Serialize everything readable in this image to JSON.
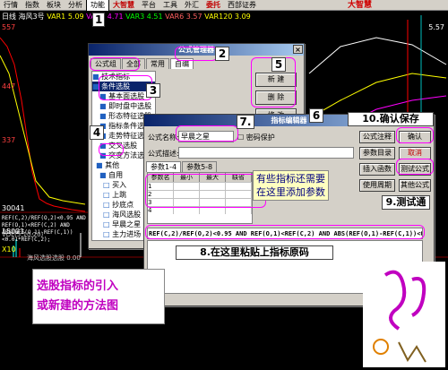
{
  "menu": [
    "行情",
    "指数",
    "板块",
    "分析",
    "功能",
    "大智慧",
    "平台",
    "工具",
    "外汇",
    "委托",
    "西部证券"
  ],
  "brand": "大智慧",
  "infoline": {
    "name": "海风3号",
    "ma1": "VAR1 5.09",
    "ma2": "VAR2 4.71",
    "ma3": "VAR3 4.51",
    "ma4": "VAR6 3.57",
    "ma5": "VAR120 3.09",
    "period": "日线"
  },
  "yticks_left": [
    "557",
    "447",
    "337"
  ],
  "yticks_right": [
    "5.57"
  ],
  "bottom_ticks": [
    "30041",
    "15021",
    "X10"
  ],
  "vol_line": "VOL(5,10,20)",
  "formula_text": "REF(C,2)/REF(O,2)<0.95 AND REF(O,1)<REF(C,2) AND ABS(REF(O,1)-REF(C,1))<0.01*REF(C,2);",
  "panel_name": "海风选股选股",
  "panel_value": "0.00",
  "selector_window": {
    "title": "公式管理器",
    "tabs": [
      "公式组",
      "全部",
      "常用",
      "自编"
    ],
    "tree": [
      "技术指标",
      "条件选股",
      "基本面选股",
      "即时盘中选股",
      "形态特征选股",
      "指标条件选股",
      "走势特征选股",
      "交叉选股",
      "突变方法选股",
      "其他",
      "自用",
      "买入",
      "上跳",
      "抄底点",
      "海风选股",
      "早晨之星",
      "主力进场",
      "突破"
    ],
    "buttons": [
      "新 建",
      "删 除",
      "修 改",
      "导 入"
    ]
  },
  "editor_window": {
    "title": "指标编辑器",
    "name_label": "公式名称:",
    "name_value": "早晨之星",
    "password_label": "密码保护",
    "desc_label": "公式描述:",
    "param_tabs": [
      "参数1-4",
      "参数5-8"
    ],
    "param_headers": [
      "参数名",
      "最小",
      "最大",
      "缺省"
    ],
    "param_rows": [
      "1",
      "2",
      "3",
      "4"
    ],
    "buttons": [
      "公式注释",
      "参数目录",
      "插入函数",
      "使用周期",
      "确认",
      "取消",
      "测试公式",
      "其他公式"
    ],
    "code": "REF(C,2)/REF(O,2)<0.95 AND REF(O,1)<REF(C,2) AND ABS(REF(O,1)-REF(C,1))<0"
  },
  "annotations": {
    "n1": "1",
    "n2": "2",
    "n3": "3",
    "n4": "4",
    "n5": "5",
    "n6": "6",
    "n7": "7.",
    "n8": "8.在这里粘贴上指标原码",
    "n9": "9.测试通",
    "n10": "10.确认保存",
    "params_note_1": "有些指标还需要",
    "params_note_2": "在这里添加参数",
    "title_1": "选股指标的引入",
    "title_2": "或新建的方法图"
  }
}
